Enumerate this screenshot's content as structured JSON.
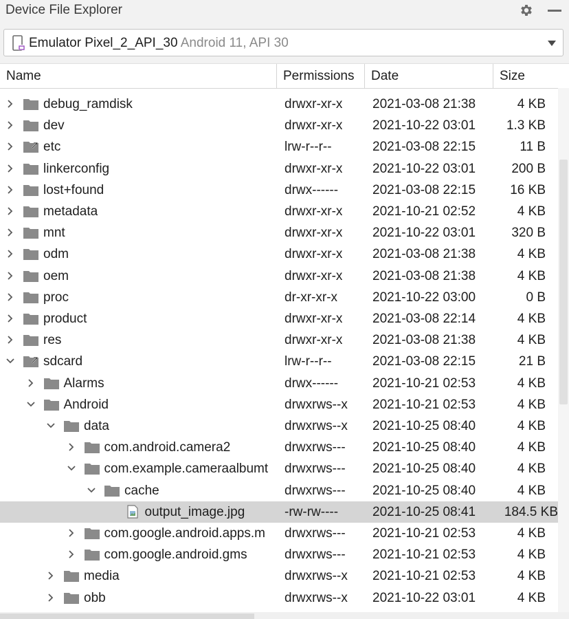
{
  "panel": {
    "title": "Device File Explorer",
    "icons": [
      "gear-icon",
      "minimize-icon"
    ]
  },
  "device": {
    "name": "Emulator Pixel_2_API_30",
    "detail": " Android 11, API 30",
    "icon": "phone-icon"
  },
  "columns": [
    "Name",
    "Permissions",
    "Date",
    "Size"
  ],
  "colors": {
    "folder": "#8a8a8a",
    "selected_row": "#d5d5d5",
    "header_bg": "#f2f2f2"
  },
  "rows": [
    {
      "name": "debug_ramdisk",
      "perm": "drwxr-xr-x",
      "date": "2021-03-08 21:38",
      "size": "4 KB"
    },
    {
      "name": "dev",
      "perm": "drwxr-xr-x",
      "date": "2021-10-22 03:01",
      "size": "1.3 KB"
    },
    {
      "name": "etc",
      "perm": "lrw-r--r--",
      "date": "2021-03-08 22:15",
      "size": "11 B"
    },
    {
      "name": "linkerconfig",
      "perm": "drwxr-xr-x",
      "date": "2021-10-22 03:01",
      "size": "200 B"
    },
    {
      "name": "lost+found",
      "perm": "drwx------",
      "date": "2021-03-08 22:15",
      "size": "16 KB"
    },
    {
      "name": "metadata",
      "perm": "drwxr-xr-x",
      "date": "2021-10-21 02:52",
      "size": "4 KB"
    },
    {
      "name": "mnt",
      "perm": "drwxr-xr-x",
      "date": "2021-10-22 03:01",
      "size": "320 B"
    },
    {
      "name": "odm",
      "perm": "drwxr-xr-x",
      "date": "2021-03-08 21:38",
      "size": "4 KB"
    },
    {
      "name": "oem",
      "perm": "drwxr-xr-x",
      "date": "2021-03-08 21:38",
      "size": "4 KB"
    },
    {
      "name": "proc",
      "perm": "dr-xr-xr-x",
      "date": "2021-10-22 03:00",
      "size": "0 B"
    },
    {
      "name": "product",
      "perm": "drwxr-xr-x",
      "date": "2021-03-08 22:14",
      "size": "4 KB"
    },
    {
      "name": "res",
      "perm": "drwxr-xr-x",
      "date": "2021-03-08 21:38",
      "size": "4 KB"
    },
    {
      "name": "sdcard",
      "perm": "lrw-r--r--",
      "date": "2021-03-08 22:15",
      "size": "21 B"
    },
    {
      "name": "Alarms",
      "perm": "drwx------",
      "date": "2021-10-21 02:53",
      "size": "4 KB"
    },
    {
      "name": "Android",
      "perm": "drwxrws--x",
      "date": "2021-10-21 02:53",
      "size": "4 KB"
    },
    {
      "name": "data",
      "perm": "drwxrws--x",
      "date": "2021-10-25 08:40",
      "size": "4 KB"
    },
    {
      "name": "com.android.camera2",
      "perm": "drwxrws---",
      "date": "2021-10-25 08:40",
      "size": "4 KB"
    },
    {
      "name": "com.example.cameraalbumt",
      "perm": "drwxrws---",
      "date": "2021-10-25 08:40",
      "size": "4 KB"
    },
    {
      "name": "cache",
      "perm": "drwxrws---",
      "date": "2021-10-25 08:40",
      "size": "4 KB"
    },
    {
      "name": "output_image.jpg",
      "perm": "-rw-rw----",
      "date": "2021-10-25 08:41",
      "size": "184.5 KB"
    },
    {
      "name": "com.google.android.apps.m",
      "perm": "drwxrws---",
      "date": "2021-10-21 02:53",
      "size": "4 KB"
    },
    {
      "name": "com.google.android.gms",
      "perm": "drwxrws---",
      "date": "2021-10-21 02:53",
      "size": "4 KB"
    },
    {
      "name": "media",
      "perm": "drwxrws--x",
      "date": "2021-10-21 02:53",
      "size": "4 KB"
    },
    {
      "name": "obb",
      "perm": "drwxrws--x",
      "date": "2021-10-22 03:01",
      "size": "4 KB"
    }
  ]
}
